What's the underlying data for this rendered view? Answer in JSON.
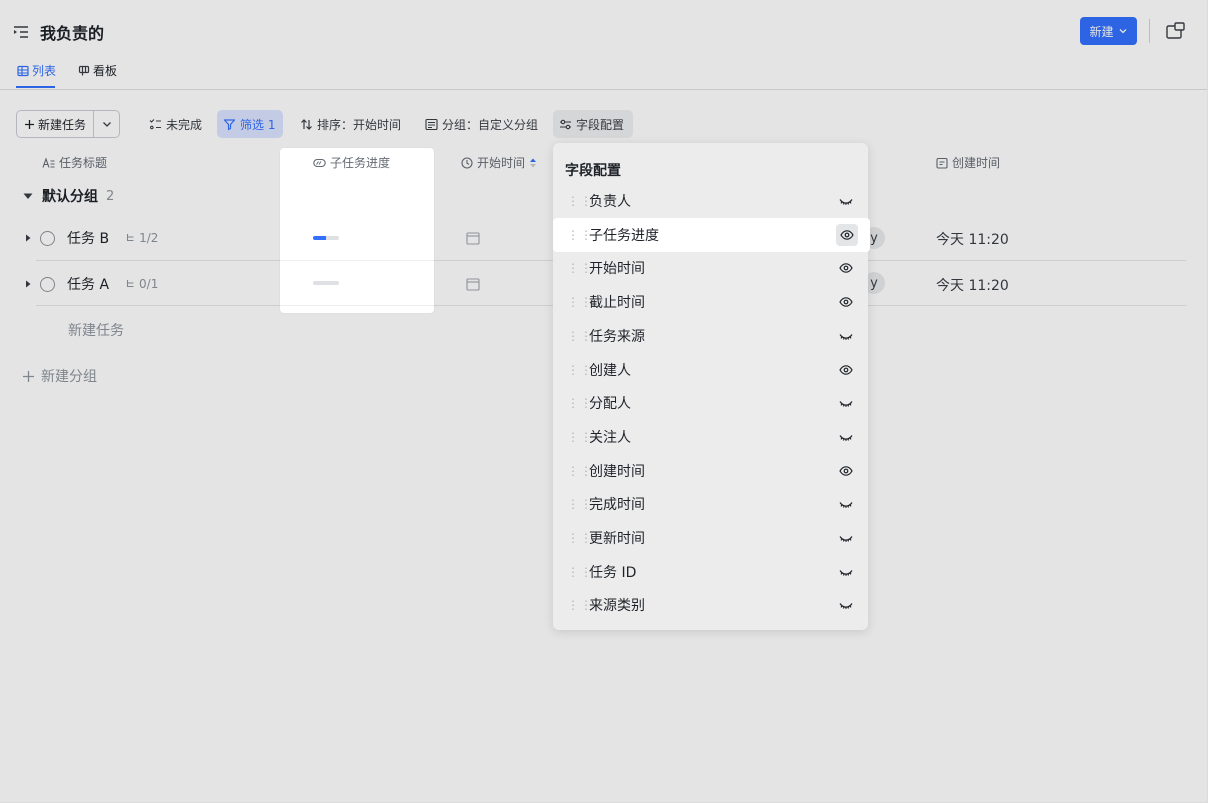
{
  "header": {
    "title": "我负责的",
    "new_button": "新建"
  },
  "tabs": [
    {
      "label": "列表",
      "active": true
    },
    {
      "label": "看板",
      "active": false
    }
  ],
  "toolbar": {
    "new_task": "新建任务",
    "incomplete": "未完成",
    "filter": "筛选 1",
    "sort": "排序：开始时间",
    "group": "分组：自定义分组",
    "field_config": "字段配置"
  },
  "columns": {
    "title": "任务标题",
    "subtask_progress": "子任务进度",
    "start_time": "开始时间",
    "created_time": "创建时间"
  },
  "group": {
    "name": "默认分组",
    "count": "2"
  },
  "tasks": [
    {
      "name": "任务 B",
      "subtasks": "1/2",
      "progress": 0.5,
      "assignee_initial": "y",
      "created": "今天 11:20"
    },
    {
      "name": "任务 A",
      "subtasks": "0/1",
      "progress": 0,
      "assignee_initial": "y",
      "created": "今天 11:20"
    }
  ],
  "add_task": "新建任务",
  "add_group": "新建分组",
  "field_popup": {
    "title": "字段配置",
    "fields": [
      {
        "label": "负责人",
        "visible": false
      },
      {
        "label": "子任务进度",
        "visible": true,
        "highlighted": true
      },
      {
        "label": "开始时间",
        "visible": true
      },
      {
        "label": "截止时间",
        "visible": true
      },
      {
        "label": "任务来源",
        "visible": false
      },
      {
        "label": "创建人",
        "visible": true
      },
      {
        "label": "分配人",
        "visible": false
      },
      {
        "label": "关注人",
        "visible": false
      },
      {
        "label": "创建时间",
        "visible": true
      },
      {
        "label": "完成时间",
        "visible": false
      },
      {
        "label": "更新时间",
        "visible": false
      },
      {
        "label": "任务 ID",
        "visible": false
      },
      {
        "label": "来源类别",
        "visible": false
      }
    ]
  },
  "colors": {
    "accent": "#3370ff",
    "text": "#1f2329",
    "muted": "#8f959e"
  }
}
